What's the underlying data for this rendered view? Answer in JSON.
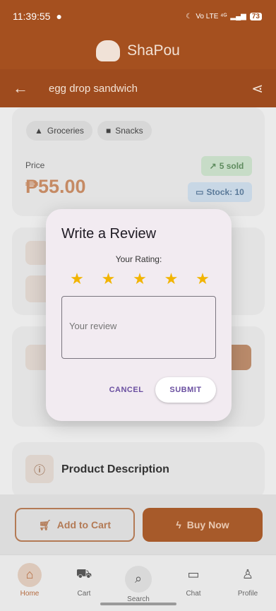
{
  "status_bar": {
    "time": "11:39:55",
    "signal_text": "Vo LTE ⁴ᴳ",
    "battery": "73"
  },
  "app": {
    "name": "ShaPou"
  },
  "product": {
    "title": "egg drop sandwich",
    "categories": [
      "Groceries",
      "Snacks"
    ],
    "price_label": "Price",
    "price": "₱55.00",
    "sold": "5 sold",
    "stock": "Stock: 10",
    "description_title": "Product Description"
  },
  "actions": {
    "add_to_cart": "Add to Cart",
    "buy_now": "Buy Now"
  },
  "nav": [
    {
      "label": "Home",
      "icon": "home-icon"
    },
    {
      "label": "Cart",
      "icon": "cart-icon"
    },
    {
      "label": "Search",
      "icon": "search-icon"
    },
    {
      "label": "Chat",
      "icon": "chat-icon"
    },
    {
      "label": "Profile",
      "icon": "profile-icon"
    }
  ],
  "dialog": {
    "title": "Write a Review",
    "rating_label": "Your Rating:",
    "rating": 5,
    "review_placeholder": "Your review",
    "cancel": "CANCEL",
    "submit": "SUBMIT"
  },
  "colors": {
    "brand": "#a5501f",
    "star": "#f2b400",
    "dialog_accent": "#6a4fa0"
  }
}
